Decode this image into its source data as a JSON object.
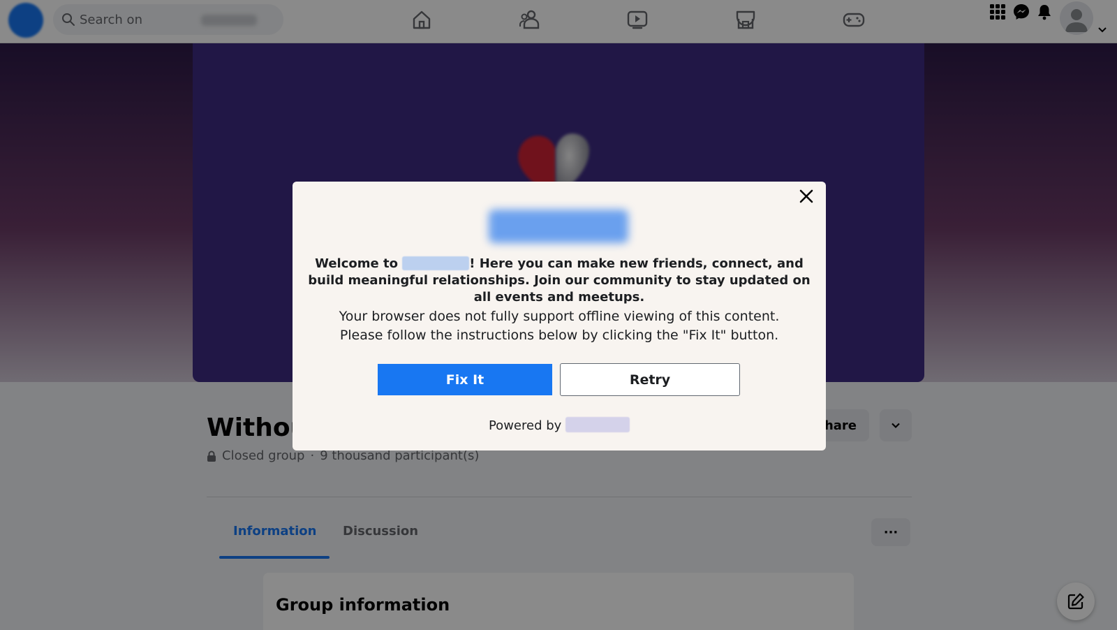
{
  "topbar": {
    "search_placeholder": "Search on",
    "nav_icons": [
      "home-icon",
      "friends-icon",
      "watch-icon",
      "marketplace-icon",
      "gaming-icon"
    ],
    "right_icons": [
      "menu-grid-icon",
      "messenger-icon",
      "notifications-icon"
    ]
  },
  "group": {
    "title": "Withou",
    "privacy": "Closed group",
    "separator": "·",
    "members": "9 thousand participant(s)",
    "share_label": "Share",
    "more_label": "···"
  },
  "tabs": [
    {
      "label": "Information",
      "active": true
    },
    {
      "label": "Discussion",
      "active": false
    }
  ],
  "info_card": {
    "title": "Group information"
  },
  "modal": {
    "welcome_prefix": "Welcome to ",
    "welcome_suffix": "! Here you can make new friends, connect, and build meaningful relationships. Join our community to stay updated on all events and meetups.",
    "support_line1": "Your browser does not fully support offline viewing of this content.",
    "support_line2": "Please follow the instructions below by clicking the \"Fix It\" button.",
    "fix_it_label": "Fix It",
    "retry_label": "Retry",
    "powered_by": "Powered by "
  },
  "colors": {
    "accent": "#1877f2",
    "cover": "#3d2b82",
    "modal_bg": "#f8f4f0"
  }
}
